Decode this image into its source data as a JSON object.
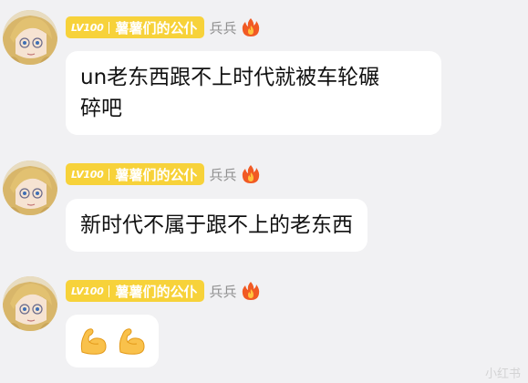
{
  "colors": {
    "background": "#f1f1f3",
    "badge_bg": "#f7d23a",
    "nickname": "#8f8f8f",
    "bubble_bg": "#ffffff",
    "fire": "#f15a24"
  },
  "messages": [
    {
      "badge_level": "LV100",
      "badge_group": "薯薯们的公仆",
      "nickname": "兵兵",
      "rank_icon": "fire-icon",
      "text_line1": "un老东西跟不上时代就被车轮碾",
      "text_line2": "碎吧"
    },
    {
      "badge_level": "LV100",
      "badge_group": "薯薯们的公仆",
      "nickname": "兵兵",
      "rank_icon": "fire-icon",
      "text_line1": "新时代不属于跟不上的老东西"
    },
    {
      "badge_level": "LV100",
      "badge_group": "薯薯们的公仆",
      "nickname": "兵兵",
      "rank_icon": "fire-icon",
      "emojis": [
        "flexed-biceps-icon",
        "flexed-biceps-icon"
      ]
    }
  ],
  "watermark": {
    "text": "小红书"
  }
}
